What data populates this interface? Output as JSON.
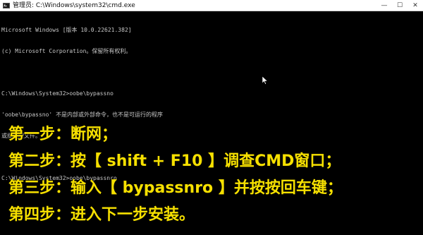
{
  "window": {
    "title": "管理员: C:\\Windows\\system32\\cmd.exe",
    "controls": {
      "minimize": "—",
      "maximize": "☐",
      "close": "✕"
    }
  },
  "console": {
    "lines": [
      "Microsoft Windows [版本 10.0.22621.382]",
      "(c) Microsoft Corporation。保留所有权利。",
      "",
      "C:\\Windows\\System32>oobe\\bypassno",
      "'oobe\\bypassno' 不是内部或外部命令，也不是可运行的程序",
      "或批处理文件。",
      "",
      "C:\\Windows\\System32>oobe\\bypassnro"
    ]
  },
  "instructions": [
    "第一步：断网；",
    "第二步：按【 shift + F10 】调查CMD窗口；",
    "第三步：输入【 bypassnro 】并按按回车键；",
    "第四步：进入下一步安装。"
  ],
  "colors": {
    "console_bg": "#000000",
    "console_text": "#c8c8c8",
    "overlay_text": "#f6e000"
  },
  "icons": [
    "cmd-app-icon",
    "minimize-icon",
    "maximize-icon",
    "close-icon",
    "mouse-pointer-icon"
  ]
}
